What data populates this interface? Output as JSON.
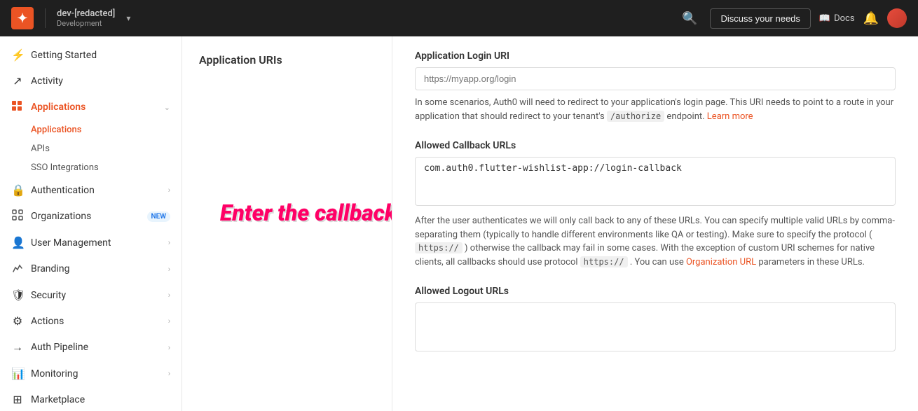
{
  "topnav": {
    "logo": "✦",
    "tenant_name": "dev-[redacted]",
    "tenant_env": "Development",
    "discuss_label": "Discuss your needs",
    "docs_label": "Docs",
    "search_icon": "🔍",
    "bell_icon": "🔔",
    "chevron": "▾"
  },
  "sidebar": {
    "items": [
      {
        "id": "getting-started",
        "label": "Getting Started",
        "icon": "⚡",
        "has_chevron": false
      },
      {
        "id": "activity",
        "label": "Activity",
        "icon": "↗",
        "has_chevron": false
      },
      {
        "id": "applications",
        "label": "Applications",
        "icon": "☰",
        "active": true,
        "has_chevron": true,
        "subitems": [
          {
            "id": "applications-sub",
            "label": "Applications",
            "active": true
          },
          {
            "id": "apis",
            "label": "APIs",
            "active": false
          },
          {
            "id": "sso",
            "label": "SSO Integrations",
            "active": false
          }
        ]
      },
      {
        "id": "authentication",
        "label": "Authentication",
        "icon": "🔒",
        "has_chevron": true
      },
      {
        "id": "organizations",
        "label": "Organizations",
        "icon": "▦",
        "badge": "NEW",
        "has_chevron": false
      },
      {
        "id": "user-management",
        "label": "User Management",
        "icon": "👤",
        "has_chevron": true
      },
      {
        "id": "branding",
        "label": "Branding",
        "icon": "◈",
        "has_chevron": true
      },
      {
        "id": "security",
        "label": "Security",
        "icon": "🛡",
        "has_chevron": true
      },
      {
        "id": "actions",
        "label": "Actions",
        "icon": "⚙",
        "has_chevron": true
      },
      {
        "id": "auth-pipeline",
        "label": "Auth Pipeline",
        "icon": "→",
        "has_chevron": true
      },
      {
        "id": "monitoring",
        "label": "Monitoring",
        "icon": "📊",
        "has_chevron": true
      },
      {
        "id": "marketplace",
        "label": "Marketplace",
        "icon": "⊞",
        "has_chevron": false
      }
    ]
  },
  "left_panel": {
    "title": "Application URIs"
  },
  "annotation": {
    "text": "Enter the callback URL here."
  },
  "right_panel": {
    "login_uri": {
      "label": "Application Login URI",
      "placeholder": "https://myapp.org/login",
      "description_before": "In some scenarios, Auth0 will need to redirect to your application's login page. This URI needs to point to a route in your application that should redirect to your tenant's",
      "code": "/authorize",
      "description_after": "endpoint.",
      "learn_more": "Learn more"
    },
    "callback_urls": {
      "label": "Allowed Callback URLs",
      "value": "com.auth0.flutter-wishlist-app://login-callback",
      "description": "After the user authenticates we will only call back to any of these URLs. You can specify multiple valid URLs by comma-separating them (typically to handle different environments like QA or testing). Make sure to specify the protocol (",
      "code1": "https://",
      "description2": ") otherwise the callback may fail in some cases. With the exception of custom URI schemes for native clients, all callbacks should use protocol",
      "code2": "https://",
      "description3": ". You can use",
      "link": "Organization URL",
      "description4": "parameters in these URLs."
    },
    "logout_urls": {
      "label": "Allowed Logout URLs",
      "value": ""
    }
  }
}
